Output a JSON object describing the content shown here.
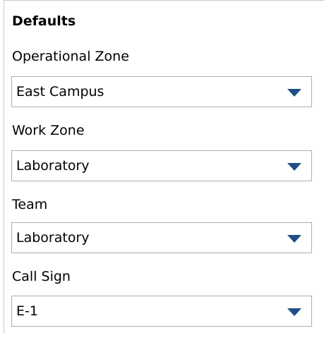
{
  "panel": {
    "title": "Defaults"
  },
  "fields": [
    {
      "label": "Operational Zone",
      "value": "East Campus"
    },
    {
      "label": "Work Zone",
      "value": "Laboratory"
    },
    {
      "label": "Team",
      "value": "Laboratory"
    },
    {
      "label": "Call Sign",
      "value": "E-1"
    }
  ],
  "colors": {
    "dropdown_arrow": "#1e4f86",
    "combo_border": "#adadad"
  },
  "icons": {
    "dropdown": "chevron-down-icon"
  }
}
